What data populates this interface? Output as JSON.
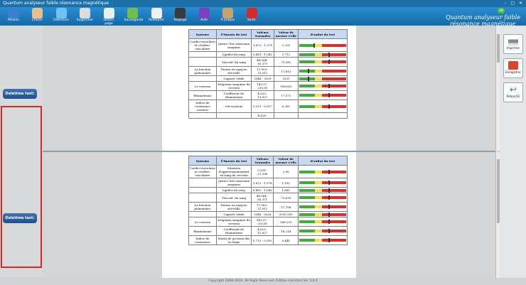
{
  "window": {
    "title": "Quantum analyseur faible résonance magnétique"
  },
  "brand": {
    "line1": "Quantum analyseur faible",
    "line2": "résonance magnétique",
    "badge": "AB"
  },
  "toolbar": [
    {
      "label": "Maison",
      "icon": "house-icon",
      "color": "#3a7fd0"
    },
    {
      "label": "Choisir",
      "icon": "users-icon",
      "color": "#e7c08f"
    },
    {
      "label": "Détection",
      "icon": "detection-icon",
      "color": "#6fc2f0"
    },
    {
      "label": "Supprimer",
      "icon": "delete-icon",
      "color": "#dcdcdc"
    },
    {
      "label": "Définir page",
      "icon": "page-setup-icon",
      "color": "#e9eef5"
    },
    {
      "label": "Sauvegarde",
      "icon": "backup-icon",
      "color": "#6fbf4a"
    },
    {
      "label": "Restaurer",
      "icon": "restore-icon",
      "color": "#f0f0f0"
    },
    {
      "label": "Réglage",
      "icon": "settings-icon",
      "color": "#3a3a3a"
    },
    {
      "label": "Aide",
      "icon": "help-icon",
      "color": "#7d3fc2"
    },
    {
      "label": "À propos",
      "icon": "about-icon",
      "color": "#c5a36b"
    },
    {
      "label": "Sortir",
      "icon": "exit-icon",
      "color": "#d22b2b"
    }
  ],
  "left": {
    "buttons": [
      "Delettma text:",
      "Delettma text:"
    ]
  },
  "right": {
    "buttons": [
      "Imprimer",
      "Enregistrer",
      "Retour(E)"
    ]
  },
  "report": {
    "headers": [
      "Systeme",
      "É'lments du test",
      "Valeurs Normales",
      "Valeur de mesure r'elle",
      "R'sultat du test"
    ],
    "rows_top": [
      {
        "sys": "Cardio-vasculaire et cérébro-vasculaire",
        "item": "Jastico' des vaisseaux sanguins",
        "norm": "1,672 - 1,978",
        "val": "1,255",
        "m": 0.3
      },
      {
        "sys": "",
        "item": "Lipides du sang",
        "norm": "0,481 - 1,043",
        "val": "1,712",
        "m": 0.62
      },
      {
        "sys": "",
        "item": "Viscosit' du sang",
        "norm": "48,264 - 65,371",
        "val": "71,082",
        "m": 0.62
      },
      {
        "sys": "La fonction pulmonaire",
        "item": "Teneur en oxyg'ne art'rielle",
        "norm": "17,903 - 21,012",
        "val": "17,813",
        "m": 0.18
      },
      {
        "sys": "",
        "item": "Capacit' vitale",
        "norm": "3348 - 3529",
        "val": "3331",
        "m": 0.18
      },
      {
        "sys": "Le cerveau",
        "item": "Irrigation sanguine du cerveau",
        "norm": "143,37 - 210,81",
        "val": "108,653",
        "m": 0.62
      },
      {
        "sys": "Rhumatisme",
        "item": "Coefficient de rhumatisme",
        "norm": "4,023 - 11,627",
        "val": "17,572",
        "m": 0.62
      },
      {
        "sys": "Indice de croissance osseuse",
        "item": "Ost'ocalcine",
        "norm": "0,321 - 0,817",
        "val": "0,382",
        "m": 0.62
      },
      {
        "sys": "",
        "item": "",
        "norm": "4,828 -",
        "val": "",
        "m": 0
      }
    ],
    "rows_bottom": [
      {
        "sys": "Cardio-vasculaire et cérébro-vasculaire",
        "item": "Situation d'approvisionnement en sang du cerveau",
        "norm": "0,138 - 21,596",
        "val": "2,96",
        "m": 0.62
      },
      {
        "sys": "",
        "item": "Jastico' des vaisseaux sanguins",
        "norm": "1,672 - 1,978",
        "val": "1,192",
        "m": 0.62
      },
      {
        "sys": "",
        "item": "Lipides du sang",
        "norm": "0,481 - 1,043",
        "val": "1,881",
        "m": 0.62
      },
      {
        "sys": "",
        "item": "Viscosit' du sang",
        "norm": "48,264 - 65,371",
        "val": "72,678",
        "m": 0.62
      },
      {
        "sys": "La fonction pulmonaire",
        "item": "Teneur en oxyg'ne art'rielle",
        "norm": "17,903 - 21,012",
        "val": "17,708",
        "m": 0.62
      },
      {
        "sys": "",
        "item": "Capacit' vitale",
        "norm": "3348 - 3529",
        "val": "3330,205",
        "m": 0.62
      },
      {
        "sys": "Le cerveau",
        "item": "Irrigation sanguine du cerveau",
        "norm": "143,37 - 210,81",
        "val": "188,291",
        "m": 0.62
      },
      {
        "sys": "Rhumatisme",
        "item": "Coefficient de rhumatisme",
        "norm": "4,023 - 11,627",
        "val": "18,214",
        "m": 0.62
      },
      {
        "sys": "Indice de croissance",
        "item": "Statut de gu'rison des os longs",
        "norm": "0,713 - 0,992",
        "val": "0,441",
        "m": 0.62
      }
    ]
  },
  "watermark": "www.mor-kon.net",
  "footer": "Copyright 2008-2016, All Right Reserved. Édition standard Ver 3.6.0"
}
